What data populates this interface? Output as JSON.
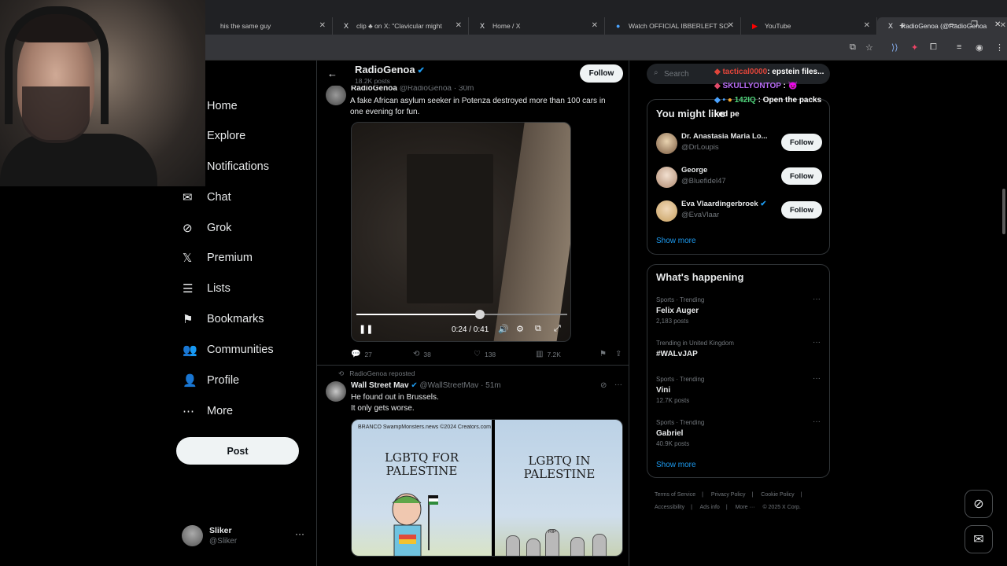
{
  "browser": {
    "tabs": [
      {
        "label": "his the same guy",
        "icon": ""
      },
      {
        "label": "clip ♣ on X: \"Clavicular might",
        "icon": "X"
      },
      {
        "label": "Home / X",
        "icon": "X"
      },
      {
        "label": "Watch OFFICIAL IBBERLEFT SO",
        "icon": "●"
      },
      {
        "label": "YouTube",
        "icon": "▶"
      },
      {
        "label": "RadioGenoa (@RadioGenoa",
        "icon": "X",
        "active": true
      }
    ],
    "new_tab": "+",
    "window_controls": [
      "—",
      "❐",
      "✕"
    ]
  },
  "nav": {
    "items": [
      {
        "label": "Home",
        "icon": "⌂"
      },
      {
        "label": "Explore",
        "icon": "⌕"
      },
      {
        "label": "Notifications",
        "icon": "🔔"
      },
      {
        "label": "Chat",
        "icon": "✉"
      },
      {
        "label": "Grok",
        "icon": "⊘"
      },
      {
        "label": "Premium",
        "icon": "𝕏"
      },
      {
        "label": "Lists",
        "icon": "☰"
      },
      {
        "label": "Bookmarks",
        "icon": "⚑"
      },
      {
        "label": "Communities",
        "icon": "👥"
      },
      {
        "label": "Profile",
        "icon": "👤"
      },
      {
        "label": "More",
        "icon": "⋯"
      }
    ],
    "post_label": "Post",
    "account": {
      "name": "Sliker",
      "handle": "@Sliker",
      "menu": "···"
    }
  },
  "header": {
    "back": "←",
    "title": "RadioGenoa",
    "verified": "✔",
    "posts_count": "18.2K posts",
    "follow_label": "Follow"
  },
  "tweet1": {
    "author": "RadioGenoa",
    "handle": "@RadioGenoa · 30m",
    "text_line1": "A fake African asylum seeker in Potenza destroyed more than 100 cars in",
    "text_line2": "one evening for fun.",
    "video": {
      "time": "0:24 / 0:41",
      "progress": 0.585
    },
    "replies": "27",
    "reposts": "38",
    "likes": "138",
    "views": "7.2K"
  },
  "tweet2": {
    "repost_label": "RadioGenoa reposted",
    "author": "Wall Street Mav",
    "handle": "@WallStreetMav · 51m",
    "text_line1": "He found out in Brussels.",
    "text_line2": "It only gets worse.",
    "cartoon": {
      "signature": "BRANCO SwampMonsters.news ©2024 Creators.com",
      "left_title": "LGBTQ FOR PALESTINE",
      "right_title": "LGBTQ IN PALESTINE",
      "tomb_text": "RIP"
    }
  },
  "right": {
    "search_placeholder": "Search",
    "might_like_title": "You might like",
    "suggestions": [
      {
        "name": "Dr. Anastasia Maria Lo...",
        "handle": "@DrLoupis",
        "follow": "Follow"
      },
      {
        "name": "George",
        "handle": "@Bluefidel47",
        "follow": "Follow"
      },
      {
        "name": "Eva Vlaardingerbroek",
        "handle": "@EvaVlaar",
        "follow": "Follow"
      }
    ],
    "show_more": "Show more",
    "happening_title": "What's happening",
    "trends": [
      {
        "context": "Sports · Trending",
        "title": "Felix Auger",
        "count": "2,183 posts"
      },
      {
        "context": "Trending in United Kingdom",
        "title": "#WALvJAP",
        "count": ""
      },
      {
        "context": "Sports · Trending",
        "title": "Vini",
        "count": "12.7K posts"
      },
      {
        "context": "Sports · Trending",
        "title": "Gabriel",
        "count": "40.9K posts"
      }
    ],
    "show_more2": "Show more",
    "footer": [
      "Terms of Service",
      "|",
      "Privacy Policy",
      "|",
      "Cookie Policy",
      "|",
      "Accessibility",
      "|",
      "Ads info",
      "|",
      "More ···",
      "© 2025 X Corp."
    ]
  },
  "chat_overlay": [
    {
      "user": "tactical0000",
      "msg": ": epstein files...",
      "color": "#e0453a"
    },
    {
      "user": "SKULLYONTOP",
      "msg": " : 😈",
      "color": "#b86cf5"
    },
    {
      "user": "142IQ",
      "msg": " : Open the packs",
      "color": "#4fd37a"
    }
  ],
  "chat_fragment": "ked pe",
  "colors": {
    "accent": "#1d9bf0",
    "bg": "#000000",
    "border": "#2f3336",
    "muted": "#71767b"
  }
}
